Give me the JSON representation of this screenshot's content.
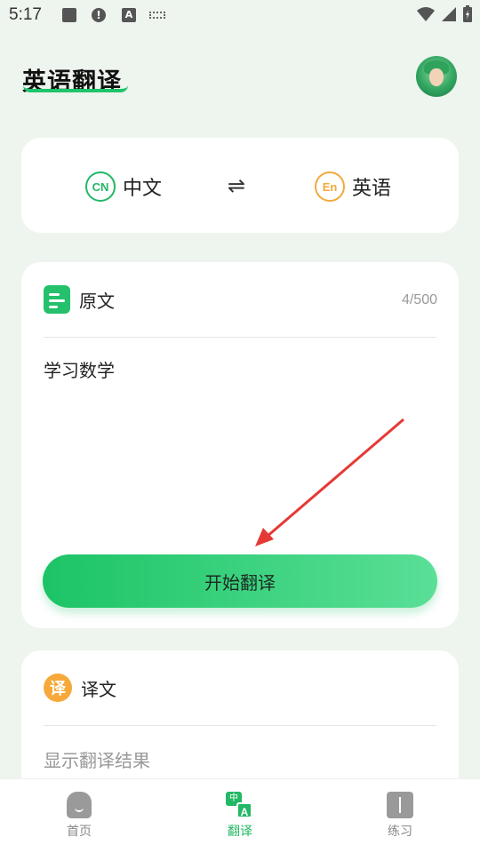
{
  "status_bar": {
    "time": "5:17"
  },
  "header": {
    "title": "英语翻译"
  },
  "languages": {
    "source": {
      "badge": "CN",
      "label": "中文"
    },
    "swap_symbol": "⇌",
    "target": {
      "badge": "En",
      "label": "英语"
    }
  },
  "source_panel": {
    "title": "原文",
    "char_count": "4/500",
    "text": "学习数学",
    "button_label": "开始翻译"
  },
  "result_panel": {
    "icon_char": "译",
    "title": "译文",
    "placeholder": "显示翻译结果"
  },
  "bottom_nav": {
    "items": [
      {
        "label": "首页"
      },
      {
        "label": "翻译",
        "icon_top": "中",
        "icon_bottom": "A"
      },
      {
        "label": "练习"
      }
    ]
  },
  "colors": {
    "accent_green": "#22b865",
    "accent_orange": "#f2a93b",
    "arrow_red": "#e53935"
  }
}
